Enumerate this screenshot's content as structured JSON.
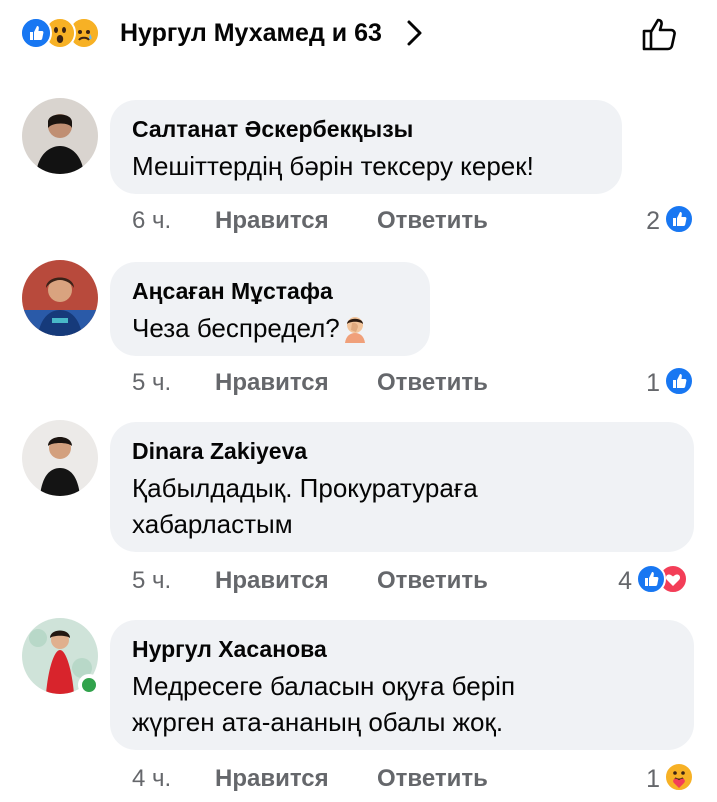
{
  "header": {
    "reactors_text": "Нургул Мухамед и 63",
    "reaction_icons": [
      "like-icon",
      "wow-icon",
      "sad-icon"
    ]
  },
  "comments": [
    {
      "author": "Салтанат Әскербекқызы",
      "text": "Мешіттердің бәрін тексеру керек!",
      "time": "6 ч.",
      "like_label": "Нравится",
      "reply_label": "Ответить",
      "reaction_count": "2",
      "reaction_icons": [
        "like-icon"
      ]
    },
    {
      "author": "Аңсаған Мұстафа",
      "text": "Чеза беспредел?",
      "text_emoji": "facepalm-icon",
      "time": "5 ч.",
      "like_label": "Нравится",
      "reply_label": "Ответить",
      "reaction_count": "1",
      "reaction_icons": [
        "like-icon"
      ]
    },
    {
      "author": "Dinara Zakiyeva",
      "text_lines": [
        "Қабылдадық. Прокуратураға",
        "хабарластым"
      ],
      "time": "5 ч.",
      "like_label": "Нравится",
      "reply_label": "Ответить",
      "reaction_count": "4",
      "reaction_icons": [
        "like-icon",
        "love-icon"
      ]
    },
    {
      "author": "Нургул Хасанова",
      "text_lines": [
        "Медресеге баласын оқуға беріп",
        "жүрген ата-ананың обалы жоқ."
      ],
      "time": "4 ч.",
      "like_label": "Нравится",
      "reply_label": "Ответить",
      "reaction_count": "1",
      "reaction_icons": [
        "care-icon"
      ],
      "online": true
    }
  ],
  "colors": {
    "bubble_bg": "#f0f2f5",
    "secondary_text": "#65676b",
    "like_blue": "#1877f2",
    "love_red": "#f33e58",
    "online_green": "#31a24c"
  }
}
